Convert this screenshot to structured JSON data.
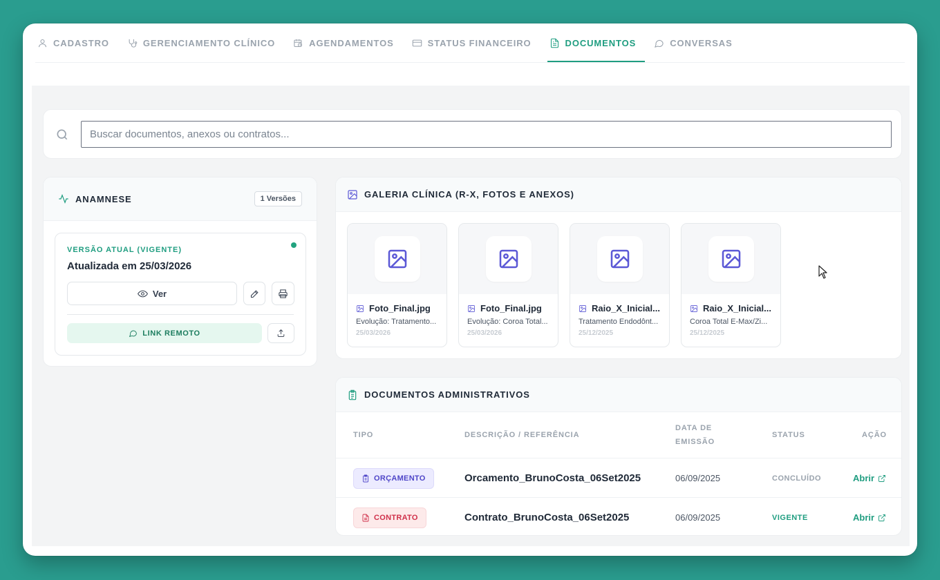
{
  "tabs": [
    {
      "label": "CADASTRO",
      "icon": "user-icon",
      "active": false
    },
    {
      "label": "GERENCIAMENTO CLÍNICO",
      "icon": "stethoscope-icon",
      "active": false
    },
    {
      "label": "AGENDAMENTOS",
      "icon": "calendar-clock-icon",
      "active": false
    },
    {
      "label": "STATUS FINANCEIRO",
      "icon": "credit-card-icon",
      "active": false
    },
    {
      "label": "DOCUMENTOS",
      "icon": "document-icon",
      "active": true
    },
    {
      "label": "CONVERSAS",
      "icon": "chat-bubble-icon",
      "active": false
    }
  ],
  "search": {
    "placeholder": "Buscar documentos, anexos ou contratos...",
    "value": ""
  },
  "anamnese": {
    "title": "ANAMNESE",
    "versions_badge": "1 Versões",
    "current_label": "VERSÃO ATUAL (VIGENTE)",
    "updated": "Atualizada em 25/03/2026",
    "view_label": "Ver",
    "remote_link_label": "LINK REMOTO"
  },
  "gallery": {
    "title": "GALERIA CLÍNICA (R-X, FOTOS E ANEXOS)",
    "items": [
      {
        "name": "Foto_Final.jpg",
        "desc": "Evolução: Tratamento...",
        "date": "25/03/2026"
      },
      {
        "name": "Foto_Final.jpg",
        "desc": "Evolução: Coroa Total...",
        "date": "25/03/2026"
      },
      {
        "name": "Raio_X_Inicial...",
        "desc": "Tratamento Endodônt...",
        "date": "25/12/2025"
      },
      {
        "name": "Raio_X_Inicial...",
        "desc": "Coroa Total E-Max/Zi...",
        "date": "25/12/2025"
      }
    ]
  },
  "admin_docs": {
    "title": "DOCUMENTOS ADMINISTRATIVOS",
    "columns": {
      "tipo": "TIPO",
      "descricao": "DESCRIÇÃO / REFERÊNCIA",
      "data_line1": "DATA DE",
      "data_line2": "EMISSÃO",
      "status": "STATUS",
      "acao": "AÇÃO"
    },
    "rows": [
      {
        "tipo": "ORÇAMENTO",
        "descricao": "Orcamento_BrunoCosta_06Set2025",
        "data": "06/09/2025",
        "status": "CONCLUÍDO",
        "status_color": "#9aa3ad",
        "acao": "Abrir"
      },
      {
        "tipo": "CONTRATO",
        "descricao": "Contrato_BrunoCosta_06Set2025",
        "data": "06/09/2025",
        "status": "VIGENTE",
        "status_color": "#1f9d80",
        "acao": "Abrir"
      }
    ]
  },
  "colors": {
    "background": "#2a9d8f",
    "accent": "#1f9d80",
    "gallery_accent": "#5b58d6",
    "danger": "#d0304a"
  }
}
